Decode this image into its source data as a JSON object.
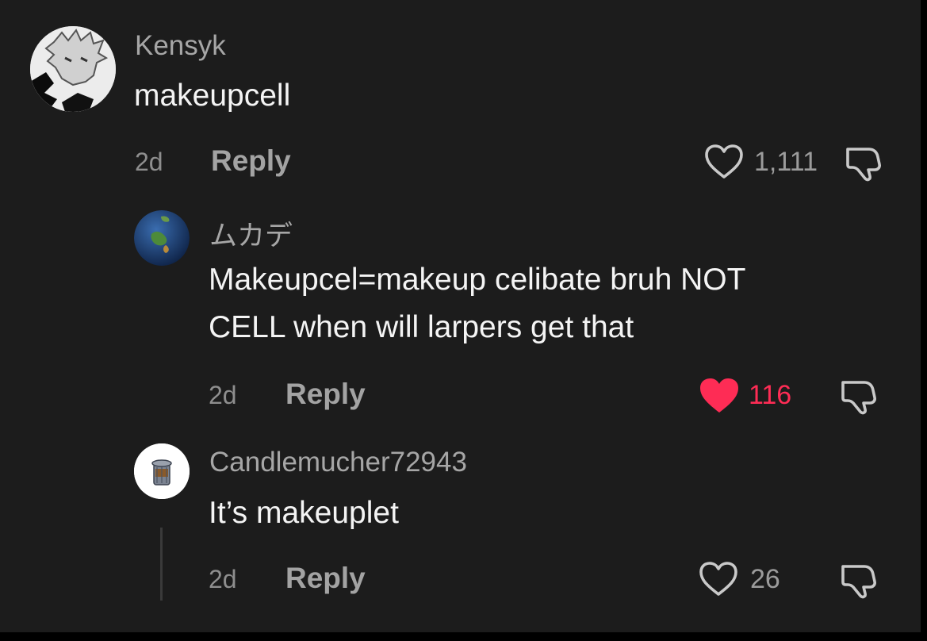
{
  "comments": [
    {
      "username": "Kensyk",
      "text_lines": [
        "makeupcell"
      ],
      "time": "2d",
      "reply_label": "Reply",
      "like_count": "1,111",
      "liked": false,
      "avatar_icon": "anime-character-avatar"
    },
    {
      "username": "ムカデ",
      "text_lines": [
        "Makeupcel=makeup celibate bruh NOT",
        "CELL when will larpers get that"
      ],
      "time": "2d",
      "reply_label": "Reply",
      "like_count": "116",
      "liked": true,
      "avatar_icon": "globe-avatar"
    },
    {
      "username": "Candlemucher72943",
      "text_lines": [
        "It’s makeuplet"
      ],
      "time": "2d",
      "reply_label": "Reply",
      "like_count": "26",
      "liked": false,
      "avatar_icon": "trash-can-avatar"
    }
  ],
  "colors": {
    "background": "#1c1c1c",
    "liked": "#fe2c55",
    "text": "#f4f4f4",
    "muted": "#8e8e8e"
  }
}
